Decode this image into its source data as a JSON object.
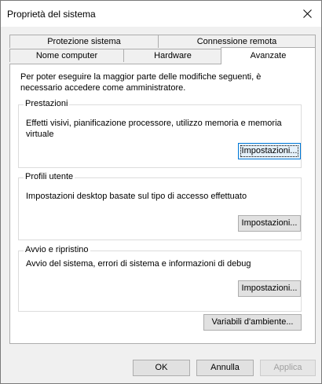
{
  "window": {
    "title": "Proprietà del sistema"
  },
  "tabs": {
    "row_back": [
      {
        "label": "Protezione sistema"
      },
      {
        "label": "Connessione remota"
      }
    ],
    "row_front": [
      {
        "label": "Nome computer"
      },
      {
        "label": "Hardware"
      },
      {
        "label": "Avanzate",
        "active": true
      }
    ]
  },
  "panel": {
    "notice": "Per poter eseguire la maggior parte delle modifiche seguenti, è necessario accedere come amministratore.",
    "groups": [
      {
        "label": "Prestazioni",
        "text": "Effetti visivi, pianificazione processore, utilizzo memoria e memoria virtuale",
        "button": "Impostazioni..."
      },
      {
        "label": "Profili utente",
        "text": "Impostazioni desktop basate sul tipo di accesso effettuato",
        "button": "Impostazioni..."
      },
      {
        "label": "Avvio e ripristino",
        "text": "Avvio del sistema, errori di sistema e informazioni di debug",
        "button": "Impostazioni..."
      }
    ],
    "env_button": "Variabili d'ambiente..."
  },
  "footer": {
    "ok": "OK",
    "cancel": "Annulla",
    "apply": "Applica"
  }
}
